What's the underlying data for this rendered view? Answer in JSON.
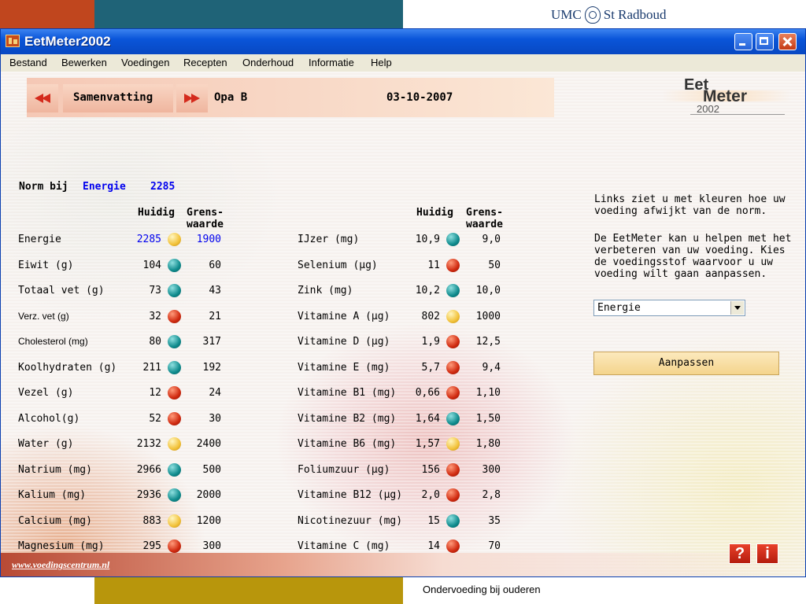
{
  "slide": {
    "logo_text_left": "UMC",
    "logo_text_right": "St Radboud",
    "caption": "Ondervoeding bij ouderen"
  },
  "window": {
    "title": "EetMeter2002"
  },
  "menu": [
    {
      "label": "Bestand"
    },
    {
      "label": "Bewerken"
    },
    {
      "label": "Voedingen"
    },
    {
      "label": "Recepten"
    },
    {
      "label": "Onderhoud"
    },
    {
      "label": "Informatie"
    },
    {
      "label": "Help"
    }
  ],
  "nav": {
    "section": "Samenvatting",
    "person": "Opa B",
    "date": "03-10-2007"
  },
  "logo": {
    "eet": "Eet",
    "meter": "Meter",
    "year": "2002"
  },
  "norm": {
    "label": "Norm bij",
    "nutrient": "Energie",
    "value": "2285"
  },
  "headers": {
    "current": "Huidig",
    "limit_line1": "Grens-",
    "limit_line2": "waarde"
  },
  "left_rows": [
    {
      "name": "Energie",
      "current": "2285",
      "limit": "1900",
      "status": "yellow"
    },
    {
      "name": "Eiwit (g)",
      "current": "104",
      "limit": "60",
      "status": "green"
    },
    {
      "name": "Totaal vet (g)",
      "current": "73",
      "limit": "43",
      "status": "green"
    },
    {
      "name": "Verz. vet (g)",
      "current": "32",
      "limit": "21",
      "status": "red"
    },
    {
      "name": "Cholesterol (mg)",
      "current": "80",
      "limit": "317",
      "status": "green"
    },
    {
      "name": "Koolhydraten (g)",
      "current": "211",
      "limit": "192",
      "status": "green"
    },
    {
      "name": "Vezel (g)",
      "current": "12",
      "limit": "24",
      "status": "red"
    },
    {
      "name": "Alcohol(g)",
      "current": "52",
      "limit": "30",
      "status": "red"
    },
    {
      "name": "Water (g)",
      "current": "2132",
      "limit": "2400",
      "status": "yellow"
    },
    {
      "name": "Natrium (mg)",
      "current": "2966",
      "limit": "500",
      "status": "green"
    },
    {
      "name": "Kalium (mg)",
      "current": "2936",
      "limit": "2000",
      "status": "green"
    },
    {
      "name": "Calcium (mg)",
      "current": "883",
      "limit": "1200",
      "status": "yellow"
    },
    {
      "name": "Magnesium (mg)",
      "current": "295",
      "limit": "300",
      "status": "red"
    }
  ],
  "right_rows": [
    {
      "name": "IJzer (mg)",
      "current": "10,9",
      "limit": "9,0",
      "status": "green"
    },
    {
      "name": "Selenium (µg)",
      "current": "11",
      "limit": "50",
      "status": "red"
    },
    {
      "name": "Zink (mg)",
      "current": "10,2",
      "limit": "10,0",
      "status": "green"
    },
    {
      "name": "Vitamine A (µg)",
      "current": "802",
      "limit": "1000",
      "status": "yellow"
    },
    {
      "name": "Vitamine D (µg)",
      "current": "1,9",
      "limit": "12,5",
      "status": "red"
    },
    {
      "name": "Vitamine E (mg)",
      "current": "5,7",
      "limit": "9,4",
      "status": "red"
    },
    {
      "name": "Vitamine B1 (mg)",
      "current": "0,66",
      "limit": "1,10",
      "status": "red"
    },
    {
      "name": "Vitamine B2 (mg)",
      "current": "1,64",
      "limit": "1,50",
      "status": "green"
    },
    {
      "name": "Vitamine B6 (mg)",
      "current": "1,57",
      "limit": "1,80",
      "status": "yellow"
    },
    {
      "name": "Foliumzuur (µg)",
      "current": "156",
      "limit": "300",
      "status": "red"
    },
    {
      "name": "Vitamine B12 (µg)",
      "current": "2,0",
      "limit": "2,8",
      "status": "red"
    },
    {
      "name": "Nicotinezuur (mg)",
      "current": "15",
      "limit": "35",
      "status": "green"
    },
    {
      "name": "Vitamine C (mg)",
      "current": "14",
      "limit": "70",
      "status": "red"
    }
  ],
  "info": {
    "paragraph1": "Links ziet u met kleuren hoe uw voeding afwijkt van de norm.",
    "paragraph2": "De EetMeter kan u helpen met het verbeteren van uw voeding. Kies de voedingsstof waarvoor u uw voeding wilt gaan aanpassen."
  },
  "nutrient_select": {
    "value": "Energie"
  },
  "adjust_button": "Aanpassen",
  "footer": {
    "link": "www.voedingscentrum.nl",
    "help": "?",
    "info": "i"
  },
  "status_colors": {
    "green": "#0f8b8d",
    "red": "#d02a10",
    "yellow": "#f2c23a"
  }
}
